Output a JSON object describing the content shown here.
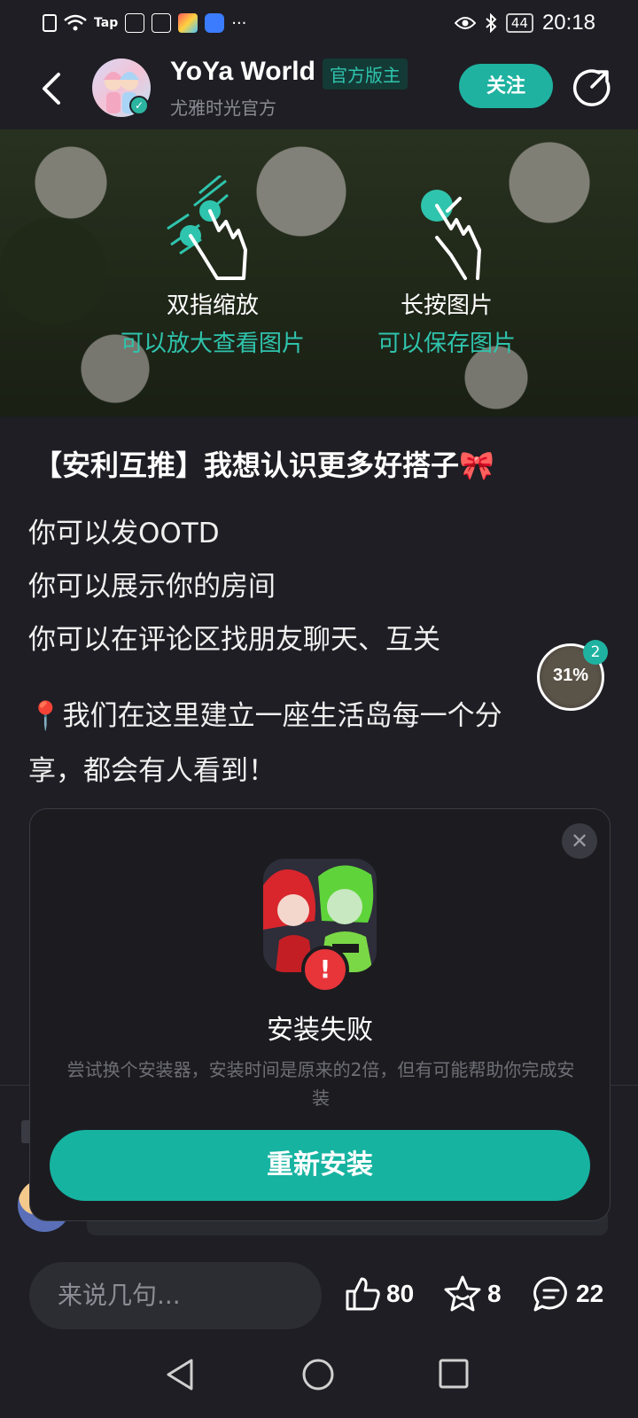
{
  "status_bar": {
    "left_icons": [
      "sim-alert-icon",
      "wifi-icon",
      "taptap-icon",
      "app-icon-1",
      "app-icon-2",
      "app-icon-3",
      "app-icon-4"
    ],
    "tap_label": "Tap",
    "more_label": "···",
    "battery": "44",
    "time": "20:18"
  },
  "header": {
    "title": "YoYa World",
    "badge": "官方版主",
    "subtitle": "尤雅时光官方",
    "follow_label": "关注"
  },
  "banner": {
    "hint_left": {
      "title": "双指缩放",
      "subtitle": "可以放大查看图片"
    },
    "hint_right": {
      "title": "长按图片",
      "subtitle": "可以保存图片"
    }
  },
  "post": {
    "title": "【安利互推】我想认识更多好搭子🎀",
    "lines": [
      "你可以发OOTD",
      "你可以展示你的房间",
      "你可以在评论区找朋友聊天、互关",
      "📍我们在这里建立一座生活岛每一个分",
      "享，都会有人看到！"
    ]
  },
  "download_progress": {
    "percent": "31%",
    "count": "2"
  },
  "dialog": {
    "title": "安装失败",
    "description": "尝试换个安装器，安装时间是原来的2倍，但有可能帮助你完成安装",
    "button_label": "重新安装",
    "close_label": "✕",
    "error_mark": "!"
  },
  "bottom_bar": {
    "input_placeholder": "来说几句...",
    "like_count": "80",
    "star_count": "8",
    "comment_count": "22"
  },
  "colors": {
    "accent": "#17b3a1",
    "background": "#1e1e24",
    "error": "#e7353a"
  }
}
